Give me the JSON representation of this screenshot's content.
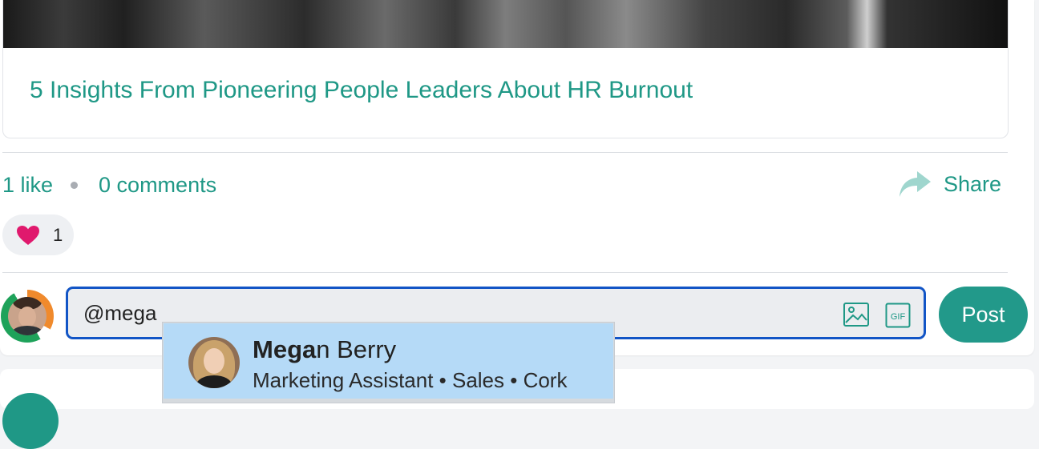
{
  "post": {
    "link_preview": {
      "title": "5 Insights From Pioneering People Leaders About HR Burnout"
    },
    "stats": {
      "likes": "1 like",
      "comments": "0 comments"
    },
    "share_label": "Share",
    "reactions": [
      {
        "icon": "heart-icon",
        "count": "1",
        "color": "#e0196d"
      }
    ]
  },
  "composer": {
    "input_text": "@mega",
    "image_icon": "image-icon",
    "gif_icon": "gif-icon",
    "gif_label": "GIF",
    "post_label": "Post"
  },
  "mention_suggestions": [
    {
      "name_match": "Mega",
      "name_rest": "n Berry",
      "details": "Marketing Assistant • Sales • Cork"
    }
  ],
  "colors": {
    "accent": "#1f9886",
    "post_button": "#22998a",
    "input_focus_border": "#1255c6",
    "suggestion_highlight": "#b5daf7",
    "heart": "#e0196d"
  }
}
